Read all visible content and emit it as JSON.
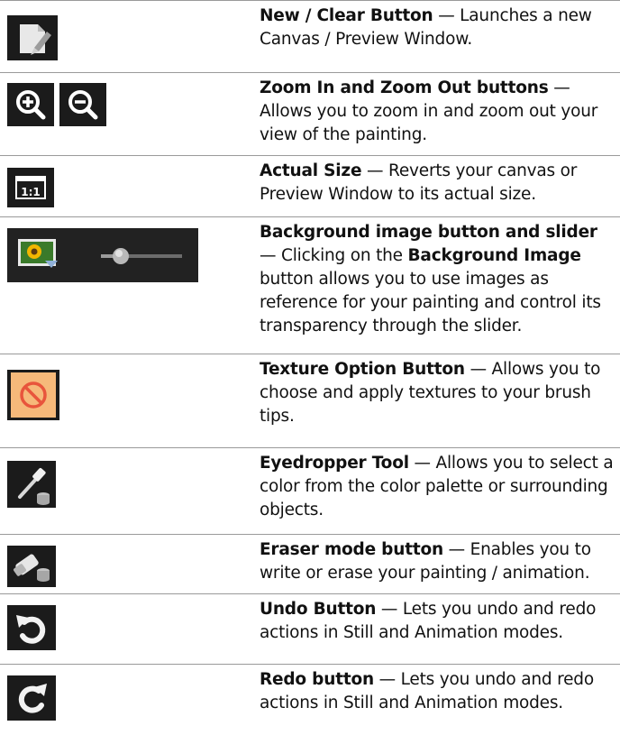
{
  "rows": [
    {
      "icon": "new-clear-icon",
      "term": "New / Clear Button",
      "text": " — Launches a new Canvas / Preview Window."
    },
    {
      "icon": "zoom-in-icon",
      "icon2": "zoom-out-icon",
      "term": "Zoom In and Zoom Out buttons",
      "text": " — Allows you to zoom in and zoom out your view of the painting."
    },
    {
      "icon": "actual-size-icon",
      "icon_text": "1:1",
      "term": "Actual Size",
      "text": " — Reverts your canvas or Preview Window to its actual size."
    },
    {
      "icon": "background-image-icon",
      "icon2": "transparency-slider-icon",
      "term": "Background image button and slider",
      "text_a": " — Clicking on the ",
      "inline_term": "Background Image",
      "text_b": " button allows you to use images as reference for your painting and control its transparency through the slider."
    },
    {
      "icon": "texture-option-icon",
      "term": "Texture Option Button",
      "text": " — Allows you to choose and apply textures to your brush tips."
    },
    {
      "icon": "eyedropper-icon",
      "term": "Eyedropper Tool",
      "text": " — Allows you to select a color from the color palette or surrounding objects."
    },
    {
      "icon": "eraser-mode-icon",
      "term": "Eraser mode button",
      "text": " — Enables you to write or erase your painting / animation."
    },
    {
      "icon": "undo-icon",
      "term": "Undo Button",
      "text": " — Lets you undo and redo actions in Still and Animation modes."
    },
    {
      "icon": "redo-icon",
      "term": "Redo button",
      "text": " — Lets you undo and redo actions in Still and Animation modes."
    }
  ],
  "colors": {
    "tile": "#1b1b1b",
    "texture_tile": "#f6b97a",
    "texture_symbol": "#e8553c",
    "rule": "#9a9a9a"
  }
}
